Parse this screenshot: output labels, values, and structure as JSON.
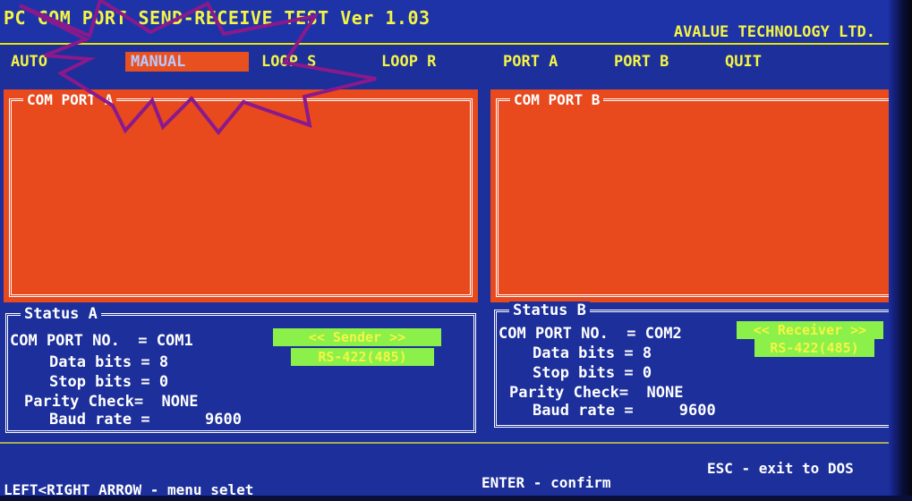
{
  "window": {
    "title": "PC COM PORT SEND-RECEIVE TEST Ver 1.03",
    "company": "AVALUE TECHNOLOGY LTD."
  },
  "menu": {
    "items": [
      {
        "label": "AUTO"
      },
      {
        "label": "MANUAL",
        "active": true
      },
      {
        "label": "LOOP S"
      },
      {
        "label": "LOOP R"
      },
      {
        "label": "PORT A"
      },
      {
        "label": "PORT B"
      },
      {
        "label": "QUIT"
      }
    ]
  },
  "panels": {
    "a": {
      "title": "COM PORT A"
    },
    "b": {
      "title": "COM PORT B"
    }
  },
  "status_a": {
    "title": "Status A",
    "com_port": "COM PORT NO.  = COM1",
    "data_bits": "Data bits = 8",
    "stop_bits": "Stop bits = 0",
    "parity": "Parity Check=  NONE",
    "baud": "Baud rate =      9600",
    "role": "<<  Sender   >>",
    "mode": "RS-422(485)"
  },
  "status_b": {
    "title": "Status B",
    "com_port": "COM PORT NO.  = COM2",
    "data_bits": "Data bits = 8",
    "stop_bits": "Stop bits = 0",
    "parity": "Parity Check=  NONE",
    "baud": "Baud rate =     9600",
    "role": "<< Receiver >>",
    "mode": "RS-422(485)"
  },
  "footer": {
    "arrows_hint": "LEFT<RIGHT ARROW - menu selet",
    "enter_hint": "ENTER - confirm",
    "esc_hint": "ESC - exit to DOS"
  },
  "colors": {
    "background": "#1c2f9a",
    "panel": "#e84a1e",
    "title_text": "#f5f544",
    "tag": "#8bf04a",
    "burst": "#8a1a8c"
  }
}
